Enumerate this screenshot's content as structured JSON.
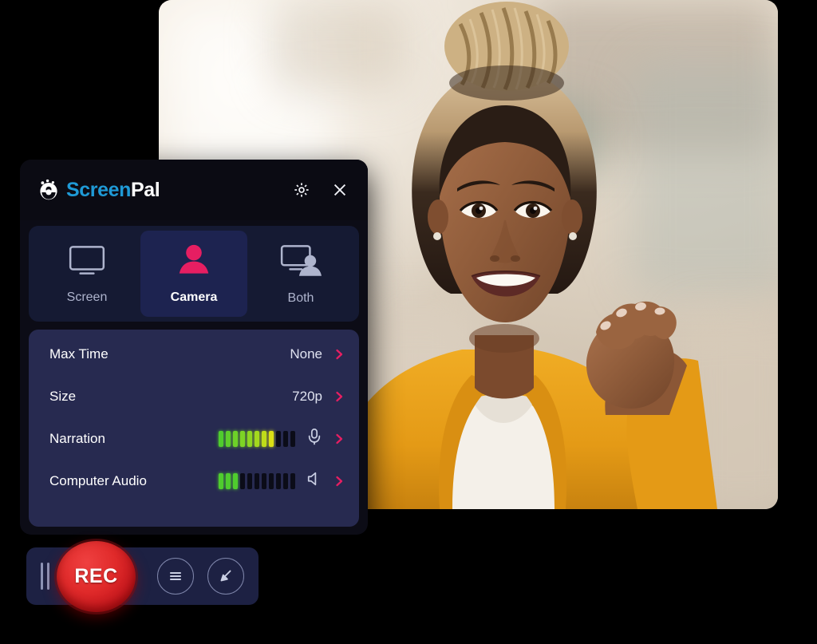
{
  "app": {
    "brand_screen": "Screen",
    "brand_pal": "Pal",
    "logo_icon": "screenpal-circle-logo-icon",
    "accent_pink": "#e61e62",
    "accent_blue": "#1f9ad6",
    "panel_bg": "#0c0c16",
    "card_bg": "#272a50",
    "toolbar_bg": "#1d2143"
  },
  "header": {
    "settings_icon": "gear-icon",
    "close_icon": "close-icon"
  },
  "modes": [
    {
      "id": "screen",
      "label": "Screen",
      "icon": "monitor-icon",
      "active": false
    },
    {
      "id": "camera",
      "label": "Camera",
      "icon": "person-icon",
      "active": true
    },
    {
      "id": "both",
      "label": "Both",
      "icon": "monitor-person-icon",
      "active": false
    }
  ],
  "settings": [
    {
      "id": "max-time",
      "label": "Max Time",
      "value": "None",
      "chevron": "chevron-right-icon"
    },
    {
      "id": "size",
      "label": "Size",
      "value": "720p",
      "chevron": "chevron-right-icon"
    }
  ],
  "audio": [
    {
      "id": "narration",
      "label": "Narration",
      "icon": "microphone-icon",
      "chevron": "chevron-right-icon",
      "meter_total": 11,
      "meter_active": 8,
      "meter_colors": [
        "#4fcc2e",
        "#5ece2b",
        "#6dd128",
        "#7dd425",
        "#8ed622",
        "#a3d91e",
        "#bfdc1a",
        "#dbe015"
      ]
    },
    {
      "id": "computer-audio",
      "label": "Computer Audio",
      "icon": "speaker-icon",
      "chevron": "chevron-right-icon",
      "meter_total": 11,
      "meter_active": 3,
      "meter_colors": [
        "#4fcc2e",
        "#4fcc2e",
        "#4fcc2e"
      ]
    }
  ],
  "toolbar": {
    "drag_handle": "drag-handle-icon",
    "record_label": "REC",
    "menu_icon": "hamburger-menu-icon",
    "draw_icon": "pen-tool-icon"
  },
  "preview": {
    "alt": "webcam-preview-person-smiling",
    "shirt_color": "#e8a21f",
    "top_color": "#f3efe8",
    "skin_color": "#8b5a3c",
    "hair_color": "#2b1d17"
  }
}
